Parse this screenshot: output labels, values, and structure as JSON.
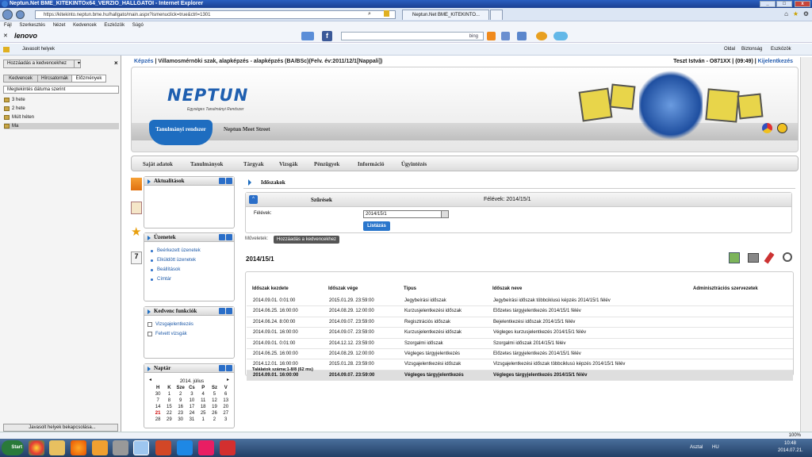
{
  "window": {
    "title": "Neptun.Net BME_KITEKINTOx64_VERZIO_HALLGATOI - Internet Explorer"
  },
  "browser": {
    "url": "https://kitekinto.neptun.bme.hu/hallgato/main.aspx?ismenuclick=true&ctrl=1301",
    "tabs": [
      "Neptun.Net BME_KITEKINTO...",
      ""
    ],
    "menu": [
      "Fájl",
      "Szerkesztés",
      "Nézet",
      "Kedvencek",
      "Eszközök",
      "Súgó"
    ],
    "brand": "lenovo",
    "search_engine": "bing",
    "fav_suggested": "Javasolt helyek",
    "cmd": [
      "Oldal",
      "Biztonság",
      "Eszközök"
    ]
  },
  "leftpane": {
    "add_fav": "Hozzáadás a kedvencekhez",
    "tabs": [
      "Kedvencek",
      "Hírcsatornák",
      "Előzmények"
    ],
    "sort": "Megtekintés dátuma szerint",
    "history": [
      "3 hete",
      "2 hete",
      "Múlt héten",
      "Ma"
    ],
    "close_suggested": "Javasolt helyek bekapcsolása..."
  },
  "neptun": {
    "crumb_label": "Képzés",
    "crumb_text": "Villamosmérnöki szak, alapképzés - alapképzés (BA/BSc)(Felv. év:2011/12/1[Nappali])",
    "user": "Teszt István - O871XX",
    "time": "(09:49)",
    "logout": "Kijelentkezés",
    "logo": "NEPTUN",
    "logo_sub": "Egységes Tanulmányi Rendszer",
    "tan_btn": "Tanulmányi rendszer",
    "meet": "Neptun Meet Street",
    "mainmenu": [
      "Saját adatok",
      "Tanulmányok",
      "Tárgyak",
      "Vizsgák",
      "Pénzügyek",
      "Információ",
      "Ügyintézés"
    ]
  },
  "widgets": {
    "aktualitasok": "Aktualitások",
    "uzenetek": {
      "title": "Üzenetek",
      "links": [
        "Beérkezett üzenetek",
        "Elküldött üzenetek",
        "Beállítások",
        "Címtár"
      ]
    },
    "kedvenc": {
      "title": "Kedvenc funkciók",
      "links": [
        "Vizsgajelentkezés",
        "Felvett vizsgák"
      ]
    },
    "naptar": {
      "title": "Naptár",
      "month": "2014. július",
      "days": [
        "H",
        "K",
        "Sze",
        "Cs",
        "P",
        "Sz",
        "V"
      ],
      "weeks": [
        [
          "30",
          "1",
          "2",
          "3",
          "4",
          "5",
          "6"
        ],
        [
          "7",
          "8",
          "9",
          "10",
          "11",
          "12",
          "13"
        ],
        [
          "14",
          "15",
          "16",
          "17",
          "18",
          "19",
          "20"
        ],
        [
          "21",
          "22",
          "23",
          "24",
          "25",
          "26",
          "27"
        ],
        [
          "28",
          "29",
          "30",
          "31",
          "1",
          "2",
          "3"
        ]
      ]
    }
  },
  "content": {
    "title": "Időszakok",
    "filter_title": "Szűrések",
    "filter_sum": "Félévek: 2014/15/1",
    "felevek_label": "Félévek:",
    "felevek_value": "2014/15/1",
    "list_btn": "Listázás",
    "muveletek": "Műveletek:",
    "add_fav": "Hozzáadás a kedvencekhez",
    "period": "2014/15/1",
    "headers": [
      "Időszak kezdete",
      "Időszak vége",
      "Típus",
      "Időszak neve",
      "Adminisztrációs szervezetek"
    ],
    "rows": [
      [
        "2014.09.01. 0:01:00",
        "2015.01.29. 23:59:00",
        "Jegybeírási időszak",
        "Jegybeírási időszak többciklusú képzés 2014/15/1 félév"
      ],
      [
        "2014.06.25. 16:00:00",
        "2014.08.29. 12:00:00",
        "Kurzusjelentkezési időszak",
        "Előzetes tárgyjelentkezés 2014/15/1 félév"
      ],
      [
        "2014.06.24. 8:00:00",
        "2014.09.07. 23:59:00",
        "Regisztrációs időszak",
        "Bejelentkezési időszak 2014/15/1 félév"
      ],
      [
        "2014.09.01. 16:00:00",
        "2014.09.07. 23:59:00",
        "Kurzusjelentkezési időszak",
        "Végleges kurzusjelentkezés 2014/15/1 félév"
      ],
      [
        "2014.09.01. 0:01:00",
        "2014.12.12. 23:59:00",
        "Szorgalmi időszak",
        "Szorgalmi időszak 2014/15/1 félév"
      ],
      [
        "2014.06.25. 16:00:00",
        "2014.08.29. 12:00:00",
        "Végleges tárgyjelentkezés",
        "Előzetes tárgyjelentkezés 2014/15/1 félév"
      ],
      [
        "2014.12.01. 16:00:00",
        "2015.01.28. 23:59:00",
        "Vizsgajelentkezési időszak",
        "Vizsgajelentkezési időszak többciklusú képzés 2014/15/1 félév"
      ],
      [
        "2014.09.01. 16:00:00",
        "2014.09.07. 23:59:00",
        "Végleges tárgyjelentkezés",
        "Végleges tárgyjelentkezés 2014/15/1 félév"
      ]
    ],
    "result_count": "Találatok száma:1-8/8 (62 ms)"
  },
  "status": {
    "zoom": "100%"
  },
  "taskbar": {
    "start": "Start",
    "desktop": "Asztal",
    "lang": "HU",
    "time": "10:48",
    "date": "2014.07.21."
  }
}
